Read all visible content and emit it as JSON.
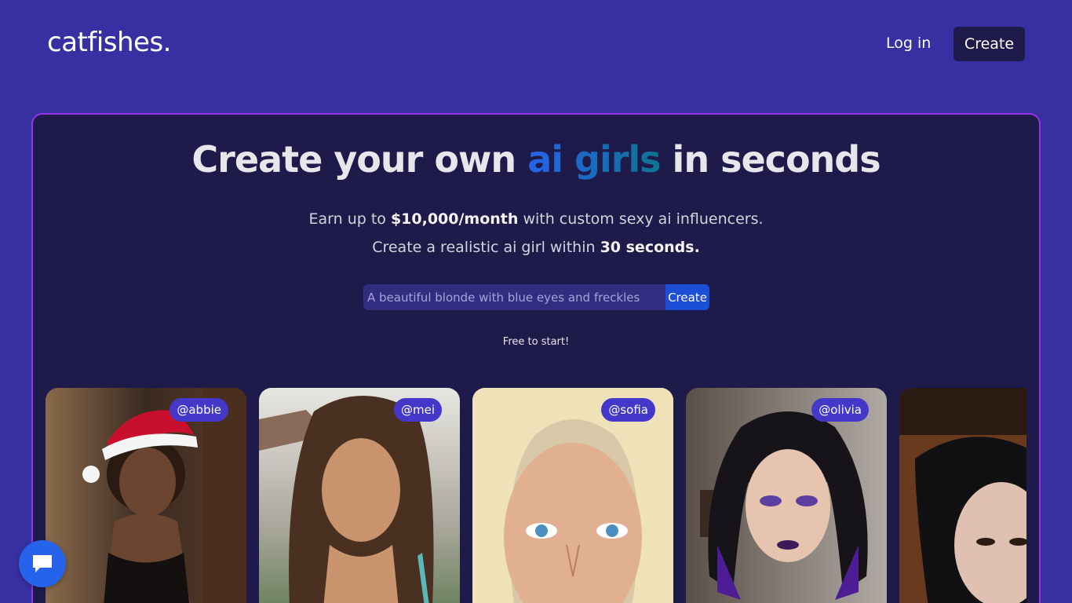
{
  "header": {
    "logo": "catfishes.",
    "login_label": "Log in",
    "create_label": "Create"
  },
  "hero": {
    "headline_pre": "Create your own ",
    "headline_highlight": "ai girls",
    "headline_post": " in seconds",
    "sub1_pre": "Earn up to ",
    "sub1_bold": "$10,000/month",
    "sub1_post": " with custom sexy ai influencers.",
    "sub2_pre": "Create a realistic ai girl within ",
    "sub2_bold": "30 seconds.",
    "prompt_placeholder": "A beautiful blonde with blue eyes and freckles",
    "prompt_button": "Create",
    "free_note": "Free to start!"
  },
  "gallery": [
    {
      "handle": "@abbie"
    },
    {
      "handle": "@mei"
    },
    {
      "handle": "@sofia"
    },
    {
      "handle": "@olivia"
    },
    {
      "handle": "@"
    }
  ],
  "colors": {
    "background": "#3730a3",
    "hero_bg": "#1e1b4b",
    "hero_border": "#9333ea",
    "accent": "#2563eb",
    "handle_badge": "#4338ca"
  },
  "icons": {
    "chat": "chat-bubble-icon"
  }
}
